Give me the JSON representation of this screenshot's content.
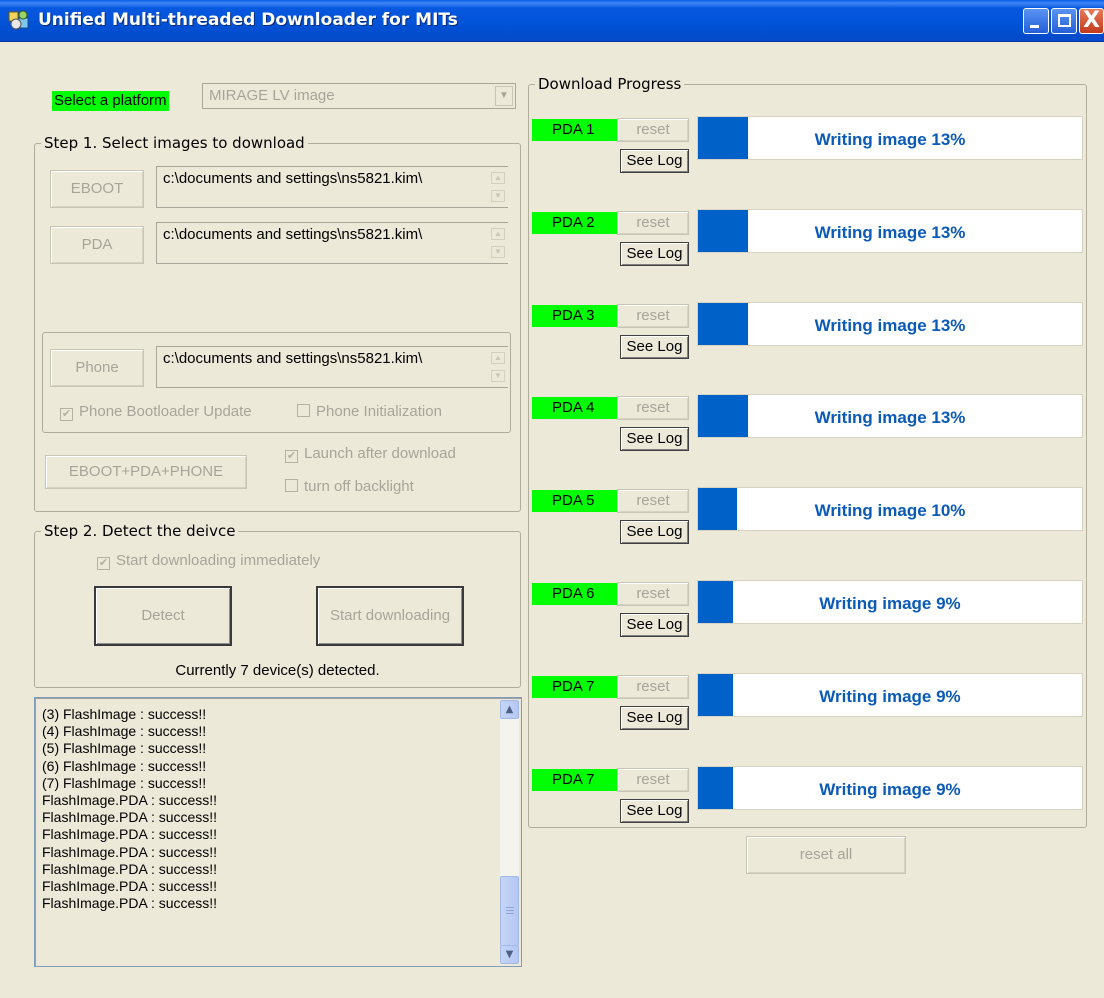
{
  "window": {
    "title": "Unified Multi-threaded Downloader for MITs",
    "close_glyph": "X"
  },
  "platform": {
    "label": "Select a platform",
    "selected": "MIRAGE LV image"
  },
  "step1": {
    "label": "Step 1. Select images to download",
    "eboot_button": "EBOOT",
    "eboot_path": "c:\\documents and settings\\ns5821.kim\\",
    "pda_button": "PDA",
    "pda_path": "c:\\documents and settings\\ns5821.kim\\",
    "phone_button": "Phone",
    "phone_path": "c:\\documents and settings\\ns5821.kim\\",
    "phone_bootloader_update": "Phone Bootloader Update",
    "phone_initialization": "Phone Initialization",
    "launch_after_download": "Launch after download",
    "turn_off_backlight": "turn off backlight",
    "all_button": "EBOOT+PDA+PHONE"
  },
  "step2": {
    "label": "Step 2. Detect the deivce",
    "start_immediately": "Start downloading immediately",
    "detect_button": "Detect",
    "start_button": "Start downloading",
    "status": "Currently 7 device(s) detected."
  },
  "log": {
    "lines": [
      "(3) FlashImage : success!!",
      "(4) FlashImage : success!!",
      "(5) FlashImage : success!!",
      "(6) FlashImage : success!!",
      "(7) FlashImage : success!!",
      "FlashImage.PDA : success!!",
      "FlashImage.PDA : success!!",
      "FlashImage.PDA : success!!",
      "FlashImage.PDA : success!!",
      "FlashImage.PDA : success!!",
      "FlashImage.PDA : success!!",
      "FlashImage.PDA : success!!"
    ]
  },
  "progress": {
    "label": "Download Progress",
    "reset_label": "reset",
    "see_log_label": "See Log",
    "reset_all_label": "reset all",
    "fill_color": "#0061c9",
    "label_color": "#00ff00",
    "devices": [
      {
        "name": "PDA 1",
        "status": "Writing image 13%",
        "fill": 0.13
      },
      {
        "name": "PDA 2",
        "status": "Writing image 13%",
        "fill": 0.13
      },
      {
        "name": "PDA 3",
        "status": "Writing image 13%",
        "fill": 0.13
      },
      {
        "name": "PDA 4",
        "status": "Writing image 13%",
        "fill": 0.13
      },
      {
        "name": "PDA 5",
        "status": "Writing image 10%",
        "fill": 0.1
      },
      {
        "name": "PDA 6",
        "status": "Writing image 9%",
        "fill": 0.09
      },
      {
        "name": "PDA 7",
        "status": "Writing image 9%",
        "fill": 0.09
      },
      {
        "name": "PDA 7",
        "status": "Writing image 9%",
        "fill": 0.09
      }
    ]
  }
}
